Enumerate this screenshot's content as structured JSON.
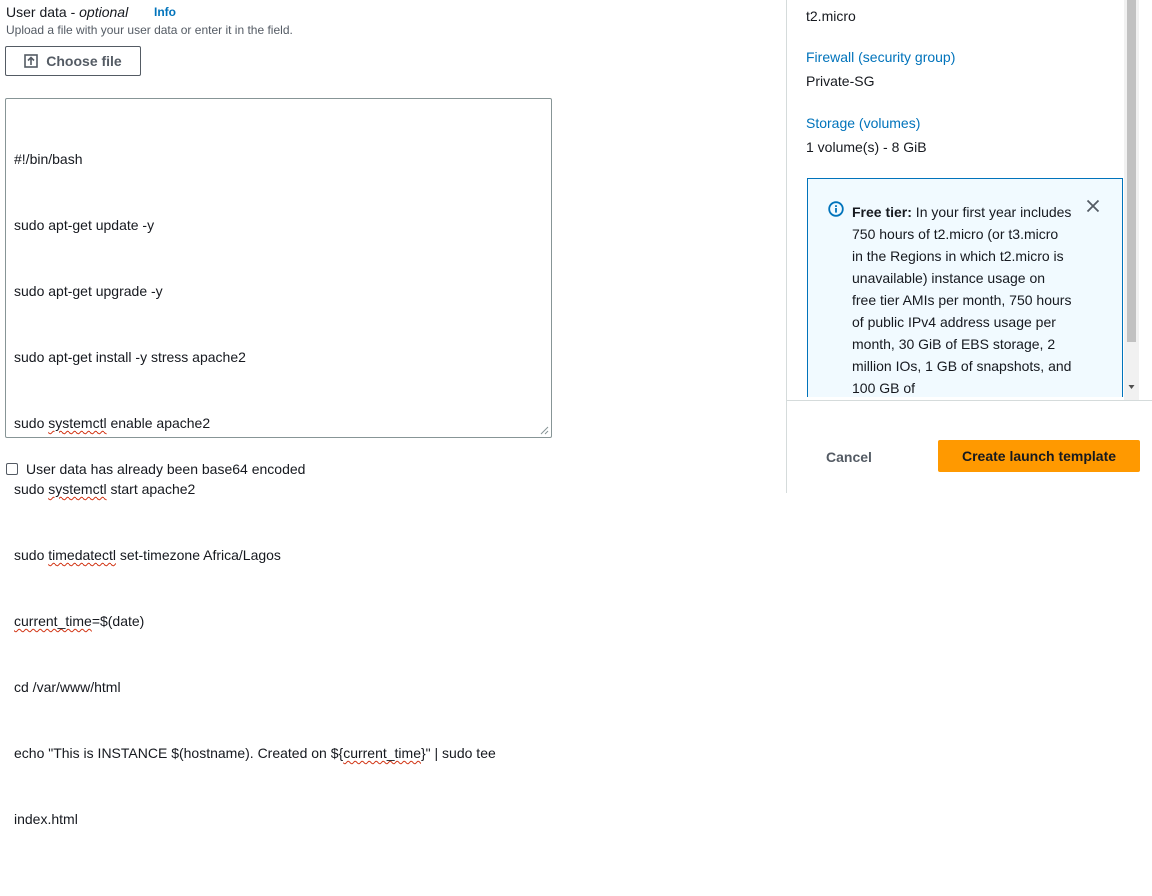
{
  "user_data": {
    "title_main": "User data - ",
    "title_italic": "optional",
    "info_label": "Info",
    "description": "Upload a file with your user data or enter it in the field.",
    "choose_file_label": "Choose file",
    "script_lines": [
      "#!/bin/bash",
      "sudo apt-get update -y",
      "sudo apt-get upgrade -y",
      "sudo apt-get install -y stress apache2",
      "sudo systemctl enable apache2",
      "sudo systemctl start apache2",
      "sudo timedatectl set-timezone Africa/Lagos",
      "current_time=$(date)",
      "cd /var/www/html",
      "echo \"This is INSTANCE $(hostname). Created on ${current_time}\" | sudo tee",
      "index.html"
    ],
    "base64_label": "User data has already been base64 encoded",
    "base64_checked": false
  },
  "summary": {
    "instance_type_value": "t2.micro",
    "firewall_label": "Firewall (security group)",
    "firewall_value": "Private-SG",
    "storage_label": "Storage (volumes)",
    "storage_value": "1 volume(s) - 8 GiB",
    "free_tier_heading": "Free tier:",
    "free_tier_text": " In your first year includes 750 hours of t2.micro (or t3.micro in the Regions in which t2.micro is unavailable) instance usage on free tier AMIs per month, 750 hours of public IPv4 address usage per month, 30 GiB of EBS storage, 2 million IOs, 1 GB of snapshots, and 100 GB of"
  },
  "footer": {
    "cancel_label": "Cancel",
    "create_label": "Create launch template"
  },
  "colors": {
    "link": "#0073bb",
    "primary_button": "#ff9900",
    "info_box_bg": "#f1faff",
    "spellcheck": "#d13212"
  },
  "icons": [
    "upload-icon",
    "info-circle-icon",
    "close-icon",
    "resize-grip-icon",
    "scroll-down-arrow-icon"
  ]
}
